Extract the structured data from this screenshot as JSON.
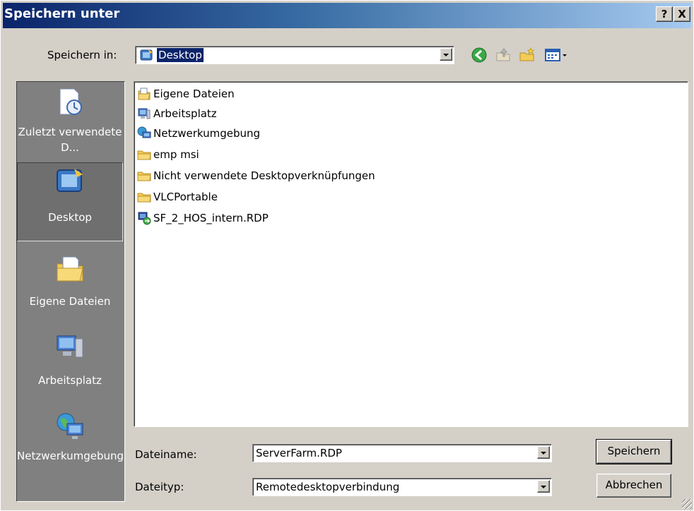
{
  "window": {
    "title": "Speichern unter",
    "help_button": "?",
    "close_button": "X"
  },
  "location": {
    "label": "Speichern in:",
    "value": "Desktop"
  },
  "toolbar": {
    "back": "back-icon",
    "up": "up-folder-icon",
    "new_folder": "new-folder-icon",
    "view_menu": "view-menu-icon"
  },
  "places": [
    {
      "label": "Zuletzt verwendete D...",
      "icon": "recent-documents-icon"
    },
    {
      "label": "Desktop",
      "icon": "desktop-icon",
      "selected": true
    },
    {
      "label": "Eigene Dateien",
      "icon": "my-documents-icon"
    },
    {
      "label": "Arbeitsplatz",
      "icon": "my-computer-icon"
    },
    {
      "label": "Netzwerkumgebung",
      "icon": "network-icon"
    }
  ],
  "files": [
    {
      "name": "Eigene Dateien",
      "icon": "my-documents-icon"
    },
    {
      "name": "Arbeitsplatz",
      "icon": "my-computer-icon"
    },
    {
      "name": "Netzwerkumgebung",
      "icon": "network-icon"
    },
    {
      "name": "emp msi",
      "icon": "folder-icon"
    },
    {
      "name": "Nicht verwendete Desktopverknüpfungen",
      "icon": "folder-icon"
    },
    {
      "name": "VLCPortable",
      "icon": "folder-icon"
    },
    {
      "name": "SF_2_HOS_intern.RDP",
      "icon": "rdp-file-icon"
    }
  ],
  "filename": {
    "label": "Dateiname:",
    "value": "ServerFarm.RDP"
  },
  "filetype": {
    "label": "Dateityp:",
    "value": "Remotedesktopverbindung"
  },
  "buttons": {
    "save": "Speichern",
    "cancel": "Abbrechen"
  },
  "colors": {
    "title_gradient_start": "#0a246a",
    "title_gradient_end": "#a6caf0",
    "selection": "#0a246a",
    "face": "#d4d0c8"
  }
}
